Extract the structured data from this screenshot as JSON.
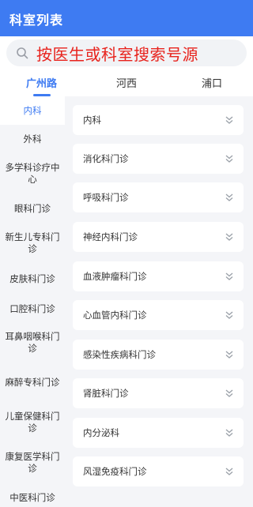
{
  "header": {
    "title": "科室列表"
  },
  "search": {
    "placeholder": "按医生或科室搜索号源"
  },
  "campus_tabs": [
    {
      "label": "广州路",
      "active": true
    },
    {
      "label": "河西",
      "active": false
    },
    {
      "label": "浦口",
      "active": false
    }
  ],
  "sidebar": {
    "items": [
      {
        "label": "内科",
        "active": true
      },
      {
        "label": "外科",
        "active": false
      },
      {
        "label": "多学科诊疗中心",
        "active": false
      },
      {
        "label": "眼科门诊",
        "active": false
      },
      {
        "label": "新生儿专科门诊",
        "active": false
      },
      {
        "label": "皮肤科门诊",
        "active": false
      },
      {
        "label": "口腔科门诊",
        "active": false
      },
      {
        "label": "耳鼻咽喉科门诊",
        "active": false
      },
      {
        "label": "麻醉专科门诊",
        "active": false
      },
      {
        "label": "儿童保健科门诊",
        "active": false
      },
      {
        "label": "康复医学科门诊",
        "active": false
      },
      {
        "label": "中医科门诊",
        "active": false
      }
    ]
  },
  "departments": [
    {
      "label": "内科"
    },
    {
      "label": "消化科门诊"
    },
    {
      "label": "呼吸科门诊"
    },
    {
      "label": "神经内科门诊"
    },
    {
      "label": "血液肿瘤科门诊"
    },
    {
      "label": "心血管内科门诊"
    },
    {
      "label": "感染性疾病科门诊"
    },
    {
      "label": "肾脏科门诊"
    },
    {
      "label": "内分泌科"
    },
    {
      "label": "风湿免疫科门诊"
    }
  ],
  "colors": {
    "accent": "#3e7bf2",
    "search_text": "#e8231d",
    "panel_bg": "#f4f5f8"
  },
  "icons": {
    "search": "search-icon",
    "expand": "chevron-double-down-icon"
  }
}
